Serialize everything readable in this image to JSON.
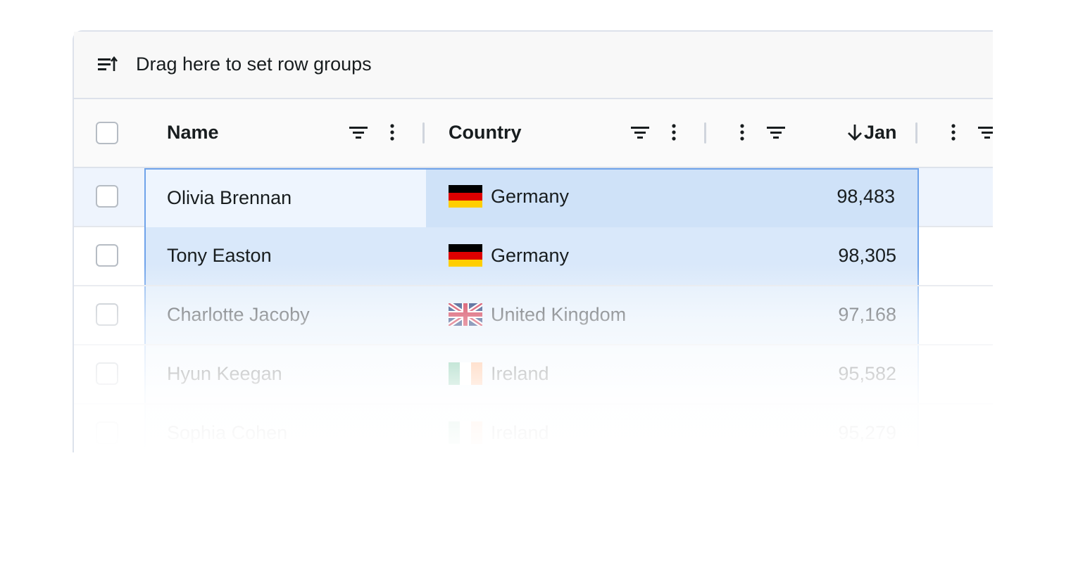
{
  "group_panel": {
    "icon": "row-group-icon",
    "text": "Drag here to set row groups"
  },
  "columns": [
    {
      "label": "Name",
      "icons": [
        "filter-icon",
        "menu-icon"
      ]
    },
    {
      "label": "Country",
      "icons": [
        "filter-icon",
        "menu-icon"
      ]
    },
    {
      "label": "Jan",
      "sort": "descending",
      "icons": [
        "menu-icon",
        "filter-icon"
      ]
    },
    {
      "label": "",
      "icons": [
        "menu-icon",
        "filter-icon"
      ]
    }
  ],
  "rows": [
    {
      "name": "Olivia Brennan",
      "country": "Germany",
      "flag": "de",
      "jan": "98,483"
    },
    {
      "name": "Tony Easton",
      "country": "Germany",
      "flag": "de",
      "jan": "98,305"
    },
    {
      "name": "Charlotte Jacoby",
      "country": "United Kingdom",
      "flag": "gb",
      "jan": "97,168"
    },
    {
      "name": "Hyun Keegan",
      "country": "Ireland",
      "flag": "ie",
      "jan": "95,582"
    },
    {
      "name": "Sophia Cohen",
      "country": "Ireland",
      "flag": "ie",
      "jan": "95,279"
    }
  ],
  "colors": {
    "selection_border": "#6fa3ea",
    "range_fill": "#cfe2f8",
    "range_fill_light": "#eaf3fd",
    "header_bg": "#fafafa",
    "border": "#dde2eb"
  }
}
